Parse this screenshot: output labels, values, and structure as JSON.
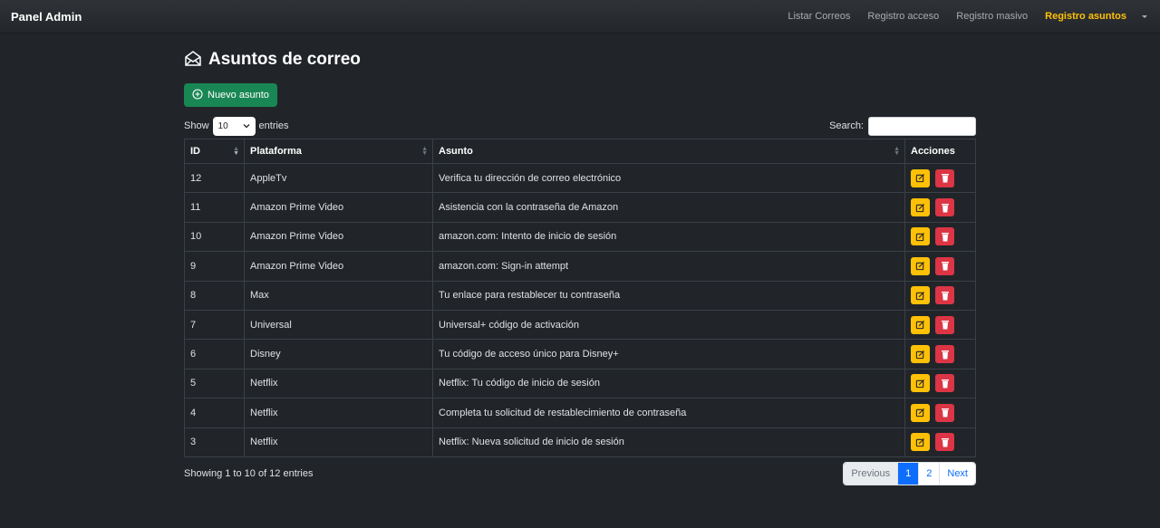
{
  "brand": "Panel Admin",
  "nav": {
    "items": [
      "Listar Correos",
      "Registro acceso",
      "Registro masivo",
      "Registro asuntos"
    ],
    "active": "Registro asuntos"
  },
  "page": {
    "title": "Asuntos de correo",
    "new_button": "Nuevo asunto"
  },
  "length": {
    "show": "Show",
    "value": "10",
    "entries": "entries"
  },
  "search": {
    "label": "Search:",
    "value": ""
  },
  "table": {
    "headers": [
      "ID",
      "Plataforma",
      "Asunto",
      "Acciones"
    ],
    "rows": [
      {
        "id": "12",
        "plataforma": "AppleTv",
        "asunto": "Verifica tu dirección de correo electrónico"
      },
      {
        "id": "11",
        "plataforma": "Amazon Prime Video",
        "asunto": "Asistencia con la contraseña de Amazon"
      },
      {
        "id": "10",
        "plataforma": "Amazon Prime Video",
        "asunto": "amazon.com: Intento de inicio de sesión"
      },
      {
        "id": "9",
        "plataforma": "Amazon Prime Video",
        "asunto": "amazon.com: Sign-in attempt"
      },
      {
        "id": "8",
        "plataforma": "Max",
        "asunto": "Tu enlace para restablecer tu contraseña"
      },
      {
        "id": "7",
        "plataforma": "Universal",
        "asunto": "Universal+ código de activación"
      },
      {
        "id": "6",
        "plataforma": "Disney",
        "asunto": "Tu código de acceso único para Disney+"
      },
      {
        "id": "5",
        "plataforma": "Netflix",
        "asunto": "Netflix: Tu código de inicio de sesión"
      },
      {
        "id": "4",
        "plataforma": "Netflix",
        "asunto": "Completa tu solicitud de restablecimiento de contraseña"
      },
      {
        "id": "3",
        "plataforma": "Netflix",
        "asunto": "Netflix: Nueva solicitud de inicio de sesión"
      }
    ]
  },
  "info": "Showing 1 to 10 of 12 entries",
  "pagination": {
    "previous": "Previous",
    "pages": [
      "1",
      "2"
    ],
    "current": "1",
    "next": "Next"
  },
  "colors": {
    "accent": "#ffc107",
    "success": "#198754",
    "danger": "#dc3545",
    "primary": "#0d6efd",
    "background": "#212529"
  },
  "icons": {
    "title": "envelope-open-icon",
    "new": "plus-circle-icon",
    "edit": "pencil-square-icon",
    "delete": "trash-icon"
  }
}
